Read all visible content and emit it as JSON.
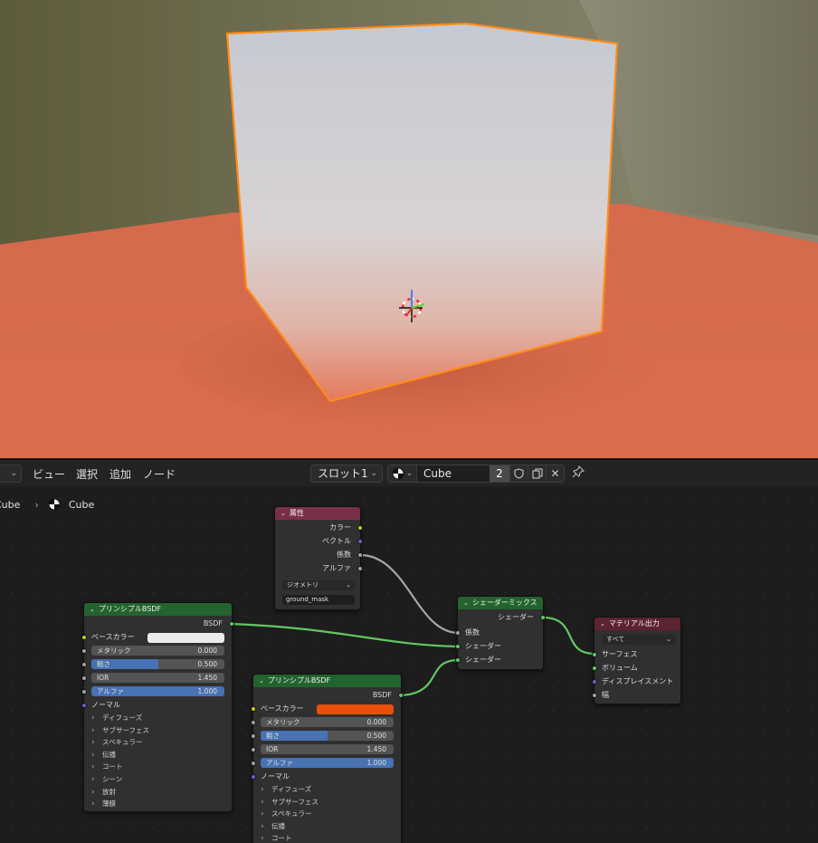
{
  "header": {
    "menus": [
      "ビュー",
      "選択",
      "追加",
      "ノード"
    ],
    "slot": "スロット1",
    "material_name": "Cube",
    "user_count": "2"
  },
  "breadcrumb": {
    "object": "Cube",
    "material": "Cube"
  },
  "colors": {
    "selection_outline": "#ff8c1a",
    "ground": "#d7694a",
    "green_header": "#23632e",
    "attr_header": "#7a2f48",
    "output_header": "#5e2330",
    "field_blue": "#4772b3",
    "base_color_2": "#e8500a"
  },
  "nodes": {
    "attribute": {
      "title": "属性",
      "outputs": [
        "カラー",
        "ベクトル",
        "係数",
        "アルファ"
      ],
      "type": "ジオメトリ",
      "name": "ground_mask"
    },
    "principled1": {
      "title": "プリンシプルBSDF",
      "output": "BSDF",
      "base_color_label": "ベースカラー",
      "metallic": {
        "label": "メタリック",
        "value": "0.000"
      },
      "roughness": {
        "label": "粗さ",
        "value": "0.500"
      },
      "ior": {
        "label": "IOR",
        "value": "1.450"
      },
      "alpha": {
        "label": "アルファ",
        "value": "1.000"
      },
      "normal": "ノーマル",
      "panels": [
        "ディフューズ",
        "サブサーフェス",
        "スペキュラー",
        "伝播",
        "コート",
        "シーン",
        "放射",
        "薄膜"
      ]
    },
    "principled2": {
      "title": "プリンシプルBSDF",
      "output": "BSDF",
      "base_color_label": "ベースカラー",
      "metallic": {
        "label": "メタリック",
        "value": "0.000"
      },
      "roughness": {
        "label": "粗さ",
        "value": "0.500"
      },
      "ior": {
        "label": "IOR",
        "value": "1.450"
      },
      "alpha": {
        "label": "アルファ",
        "value": "1.000"
      },
      "normal": "ノーマル",
      "panels": [
        "ディフューズ",
        "サブサーフェス",
        "スペキュラー",
        "伝播",
        "コート"
      ]
    },
    "mix": {
      "title": "シェーダーミックス",
      "output": "シェーダー",
      "inputs": [
        "係数",
        "シェーダー",
        "シェーダー"
      ]
    },
    "output": {
      "title": "マテリアル出力",
      "target": "すべて",
      "inputs": [
        "サーフェス",
        "ボリューム",
        "ディスプレイスメント",
        "幅"
      ]
    }
  }
}
